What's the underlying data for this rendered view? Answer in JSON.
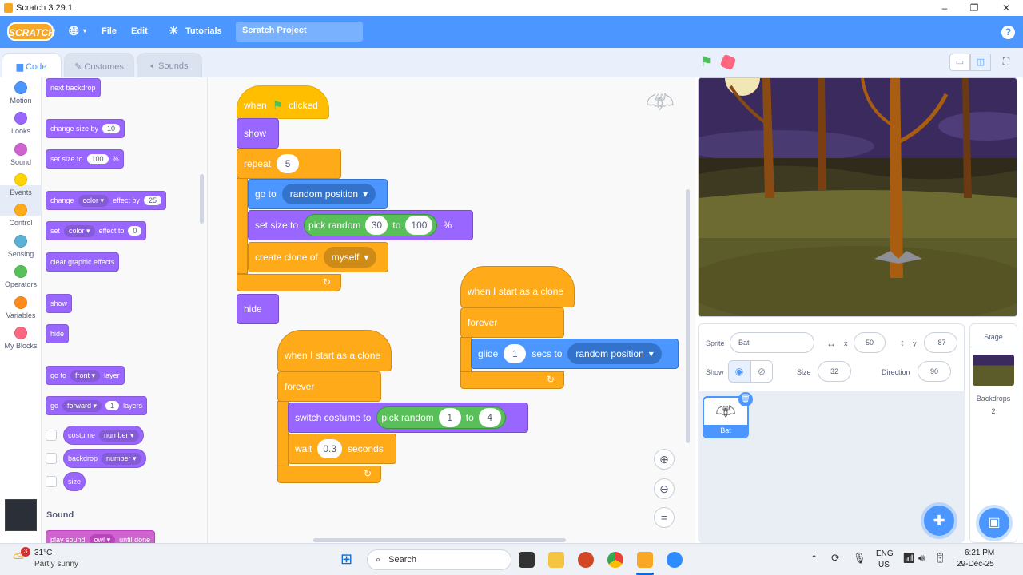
{
  "window": {
    "title": "Scratch 3.29.1",
    "controls": [
      "–",
      "❐",
      "✕"
    ]
  },
  "menu": {
    "logo": "SCRATCH",
    "file": "File",
    "edit": "Edit",
    "tutorials": "Tutorials",
    "project_title": "Scratch Project",
    "help": "?"
  },
  "tabs": {
    "code": "Code",
    "costumes": "Costumes",
    "sounds": "Sounds"
  },
  "categories": [
    {
      "label": "Motion",
      "color": "#4c97ff"
    },
    {
      "label": "Looks",
      "color": "#9966ff"
    },
    {
      "label": "Sound",
      "color": "#cf63cf"
    },
    {
      "label": "Events",
      "color": "#ffd500"
    },
    {
      "label": "Control",
      "color": "#ffab19"
    },
    {
      "label": "Sensing",
      "color": "#5cb1d6"
    },
    {
      "label": "Operators",
      "color": "#59c059"
    },
    {
      "label": "Variables",
      "color": "#ff8c1a"
    },
    {
      "label": "My Blocks",
      "color": "#ff6680"
    }
  ],
  "palette": {
    "next_backdrop": "next backdrop",
    "change_size_by": "change size by",
    "change_size_val": "10",
    "set_size_to": "set size to",
    "set_size_val": "100",
    "pct": "%",
    "change_effect": "change",
    "effect_name": "color",
    "effect_by": "effect by",
    "change_effect_val": "25",
    "set_effect": "set",
    "set_effect_to": "effect to",
    "set_effect_val": "0",
    "clear_effects": "clear graphic effects",
    "show": "show",
    "hide": "hide",
    "go_to": "go to",
    "front": "front",
    "layer": "layer",
    "go": "go",
    "forward": "forward",
    "layers_val": "1",
    "layers": "layers",
    "costume": "costume",
    "number": "number",
    "backdrop": "backdrop",
    "size": "size",
    "sound_header": "Sound",
    "play_sound": "play sound",
    "sound_name": "owl",
    "until_done": "until done"
  },
  "script1": {
    "when": "when",
    "clicked": "clicked",
    "show": "show",
    "repeat": "repeat",
    "repeat_val": "5",
    "go_to": "go to",
    "random_position": "random position",
    "set_size_to": "set size to",
    "pick_random": "pick random",
    "r_from": "30",
    "to": "to",
    "r_to": "100",
    "pct": "%",
    "create_clone_of": "create clone of",
    "myself": "myself",
    "hide": "hide"
  },
  "script2": {
    "hat": "when I start as a clone",
    "forever": "forever",
    "switch_costume_to": "switch costume to",
    "pick_random": "pick random",
    "r_from": "1",
    "to": "to",
    "r_to": "4",
    "wait": "wait",
    "wait_val": "0.3",
    "seconds": "seconds"
  },
  "script3": {
    "hat": "when I start as a clone",
    "forever": "forever",
    "glide": "glide",
    "glide_val": "1",
    "secs_to": "secs to",
    "random_position": "random position"
  },
  "sprite_info": {
    "sprite_label": "Sprite",
    "sprite_name": "Bat",
    "x_label": "x",
    "x_val": "50",
    "y_label": "y",
    "y_val": "-87",
    "show_label": "Show",
    "size_label": "Size",
    "size_val": "32",
    "direction_label": "Direction",
    "direction_val": "90",
    "thumb_name": "Bat"
  },
  "stage_pane": {
    "title": "Stage",
    "backdrops_label": "Backdrops",
    "backdrops_count": "2"
  },
  "taskbar": {
    "temp": "31°C",
    "weather": "Partly sunny",
    "weather_badge": "3",
    "search": "Search",
    "lang1": "ENG",
    "lang2": "US",
    "time": "6:21 PM",
    "date": "29-Dec-25"
  }
}
